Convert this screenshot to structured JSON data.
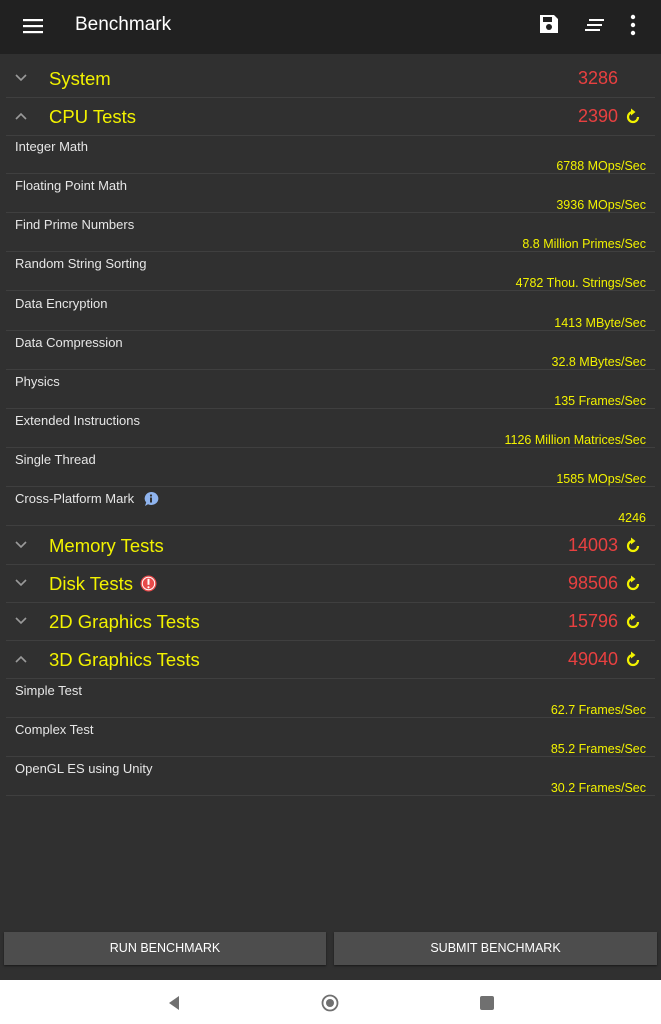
{
  "appbar": {
    "title": "Benchmark",
    "icons": [
      "menu-icon",
      "save-icon",
      "sort-icon",
      "more-vert-icon"
    ]
  },
  "categories": {
    "system": {
      "label": "System",
      "score": "3286"
    },
    "cpu": {
      "label": "CPU Tests",
      "score": "2390"
    },
    "memory": {
      "label": "Memory Tests",
      "score": "14003"
    },
    "disk": {
      "label": "Disk Tests",
      "score": "98506"
    },
    "graphics2d": {
      "label": "2D Graphics Tests",
      "score": "15796"
    },
    "graphics3d": {
      "label": "3D Graphics Tests",
      "score": "49040"
    }
  },
  "cpu_tests": [
    {
      "name": "Integer Math",
      "value": "6788 MOps/Sec"
    },
    {
      "name": "Floating Point Math",
      "value": "3936 MOps/Sec"
    },
    {
      "name": "Find Prime Numbers",
      "value": "8.8 Million Primes/Sec"
    },
    {
      "name": "Random String Sorting",
      "value": "4782 Thou. Strings/Sec"
    },
    {
      "name": "Data Encryption",
      "value": "1413 MByte/Sec"
    },
    {
      "name": "Data Compression",
      "value": "32.8 MBytes/Sec"
    },
    {
      "name": "Physics",
      "value": "135 Frames/Sec"
    },
    {
      "name": "Extended Instructions",
      "value": "1126 Million Matrices/Sec"
    },
    {
      "name": "Single Thread",
      "value": "1585 MOps/Sec"
    },
    {
      "name": "Cross-Platform Mark",
      "value": "4246"
    }
  ],
  "graphics3d_tests": [
    {
      "name": "Simple Test",
      "value": "62.7 Frames/Sec"
    },
    {
      "name": "Complex Test",
      "value": "85.2 Frames/Sec"
    },
    {
      "name": "OpenGL ES using Unity",
      "value": "30.2 Frames/Sec"
    }
  ],
  "buttons": {
    "run": "RUN BENCHMARK",
    "submit": "SUBMIT BENCHMARK"
  },
  "colors": {
    "appbar": "#212121",
    "background": "#303030",
    "category_label": "#f2f200",
    "score": "#e84040",
    "test_value": "#f2f200"
  }
}
